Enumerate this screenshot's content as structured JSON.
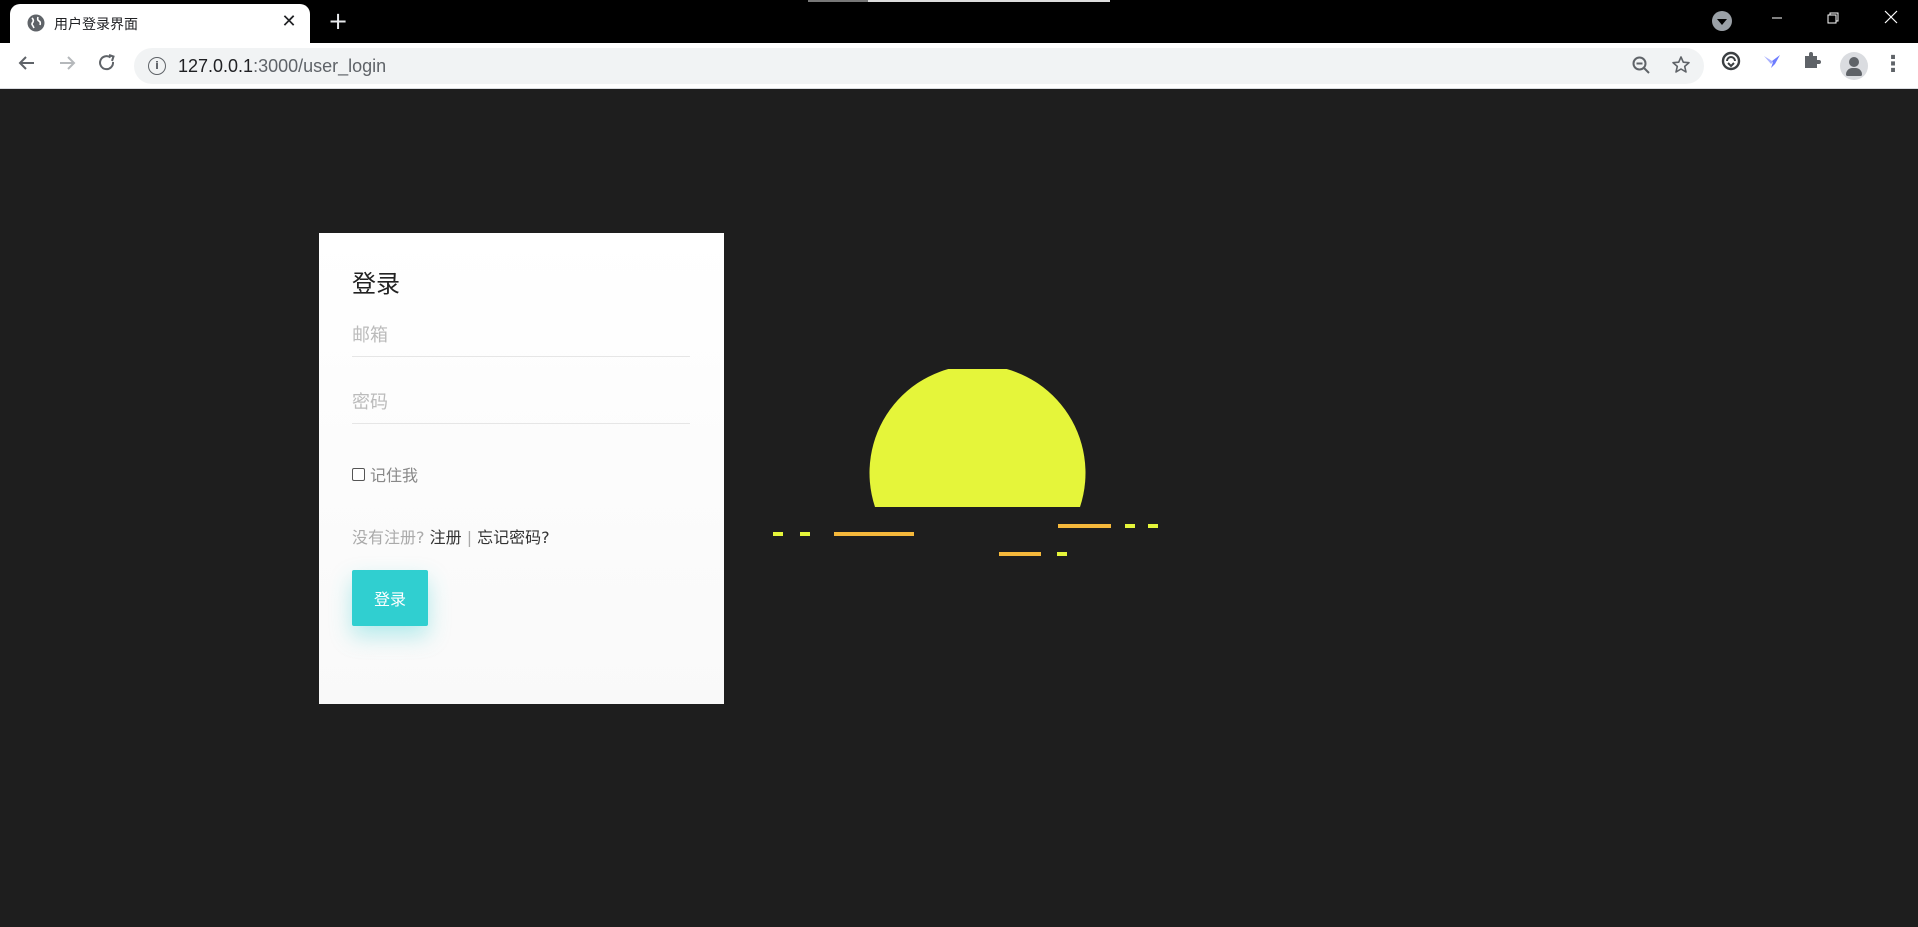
{
  "browser": {
    "tab_title": "用户登录界面",
    "tab_close": "✕",
    "new_tab": "+",
    "url_host": "127.0.0.1",
    "url_rest": ":3000/user_login",
    "icons": {
      "favicon": "globe-icon",
      "info": "info-icon",
      "zoom": "zoom-out-icon",
      "bookmark": "star-icon",
      "extensions": [
        "sync-icon",
        "bird-extension-icon",
        "puzzle-icon"
      ],
      "profile": "avatar-icon",
      "menu": "kebab-icon"
    }
  },
  "login": {
    "title": "登录",
    "email_placeholder": "邮箱",
    "password_placeholder": "密码",
    "remember_label": "记住我",
    "no_account_prefix": "没有注册? ",
    "register_link": "注册",
    "separator": " | ",
    "forgot_link": "忘记密码?",
    "submit_label": "登录"
  },
  "colors": {
    "background": "#1e1e1e",
    "card": "#ffffff",
    "button": "#30cfd0",
    "sun": "#e5f53a",
    "dash_yellow": "#e5f53a",
    "dash_orange": "#f5b83b"
  }
}
